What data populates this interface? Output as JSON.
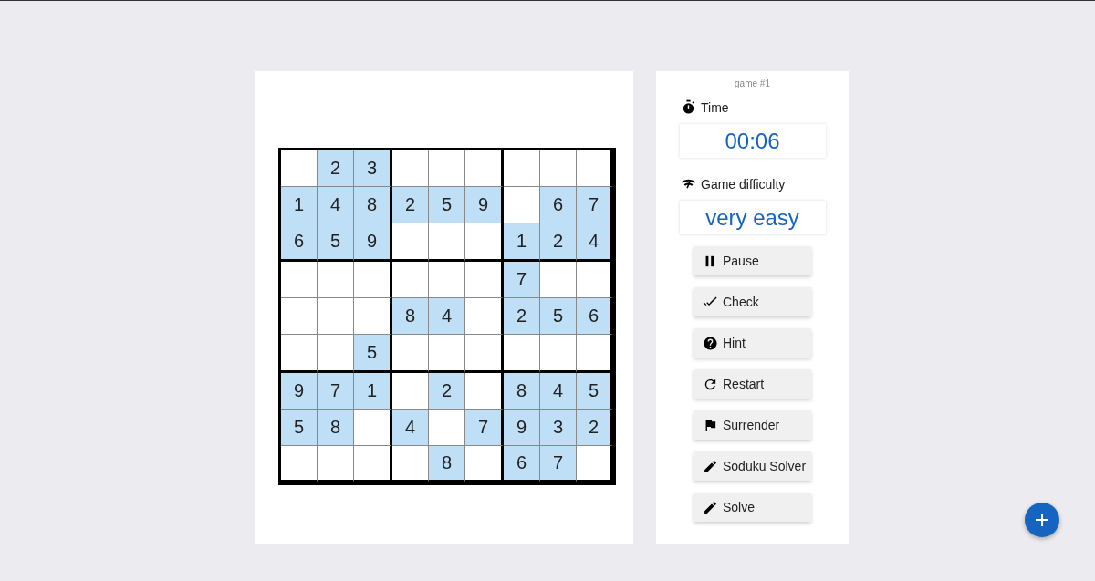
{
  "grid": {
    "rows": [
      {
        "cells": [
          {
            "given": false
          },
          {
            "value": "2",
            "given": true
          },
          {
            "value": "3",
            "given": true
          },
          {
            "given": false
          },
          {
            "given": false
          },
          {
            "given": false
          },
          {
            "given": false
          },
          {
            "given": false
          },
          {
            "given": false
          }
        ]
      },
      {
        "cells": [
          {
            "value": "1",
            "given": true
          },
          {
            "value": "4",
            "given": true
          },
          {
            "value": "8",
            "given": true
          },
          {
            "value": "2",
            "given": true
          },
          {
            "value": "5",
            "given": true
          },
          {
            "value": "9",
            "given": true
          },
          {
            "given": false
          },
          {
            "value": "6",
            "given": true
          },
          {
            "value": "7",
            "given": true
          }
        ]
      },
      {
        "cells": [
          {
            "value": "6",
            "given": true
          },
          {
            "value": "5",
            "given": true
          },
          {
            "value": "9",
            "given": true
          },
          {
            "given": false
          },
          {
            "given": false
          },
          {
            "given": false
          },
          {
            "value": "1",
            "given": true
          },
          {
            "value": "2",
            "given": true
          },
          {
            "value": "4",
            "given": true
          }
        ]
      },
      {
        "cells": [
          {
            "given": false
          },
          {
            "given": false
          },
          {
            "given": false
          },
          {
            "given": false
          },
          {
            "given": false
          },
          {
            "given": false
          },
          {
            "value": "7",
            "given": true
          },
          {
            "given": false
          },
          {
            "given": false
          }
        ]
      },
      {
        "cells": [
          {
            "given": false
          },
          {
            "given": false
          },
          {
            "given": false
          },
          {
            "value": "8",
            "given": true
          },
          {
            "value": "4",
            "given": true
          },
          {
            "given": false
          },
          {
            "value": "2",
            "given": true
          },
          {
            "value": "5",
            "given": true
          },
          {
            "value": "6",
            "given": true
          }
        ]
      },
      {
        "cells": [
          {
            "given": false
          },
          {
            "given": false
          },
          {
            "value": "5",
            "given": true
          },
          {
            "given": false
          },
          {
            "given": false
          },
          {
            "given": false
          },
          {
            "given": false
          },
          {
            "given": false
          },
          {
            "given": false
          }
        ]
      },
      {
        "cells": [
          {
            "value": "9",
            "given": true
          },
          {
            "value": "7",
            "given": true
          },
          {
            "value": "1",
            "given": true
          },
          {
            "given": false
          },
          {
            "value": "2",
            "given": true
          },
          {
            "given": false
          },
          {
            "value": "8",
            "given": true
          },
          {
            "value": "4",
            "given": true
          },
          {
            "value": "5",
            "given": true
          }
        ]
      },
      {
        "cells": [
          {
            "value": "5",
            "given": true
          },
          {
            "value": "8",
            "given": true
          },
          {
            "given": false
          },
          {
            "value": "4",
            "given": true
          },
          {
            "given": false
          },
          {
            "value": "7",
            "given": true
          },
          {
            "value": "9",
            "given": true
          },
          {
            "value": "3",
            "given": true
          },
          {
            "value": "2",
            "given": true
          }
        ]
      },
      {
        "cells": [
          {
            "given": false
          },
          {
            "given": false
          },
          {
            "given": false
          },
          {
            "given": false
          },
          {
            "value": "8",
            "given": true
          },
          {
            "given": false
          },
          {
            "value": "6",
            "given": true
          },
          {
            "value": "7",
            "given": true
          },
          {
            "given": false
          }
        ]
      }
    ]
  },
  "panel": {
    "game_label": "game #1",
    "time_label": "Time",
    "time_value": "00:06",
    "difficulty_label": "Game difficulty",
    "difficulty_value": "very easy",
    "buttons": [
      {
        "label": "Pause",
        "kind": "pause"
      },
      {
        "label": "Check",
        "kind": "check"
      },
      {
        "label": "Hint",
        "kind": "hint"
      },
      {
        "label": "Restart",
        "kind": "restart"
      },
      {
        "label": "Surrender",
        "kind": "flag"
      },
      {
        "label": "Soduku Solver",
        "kind": "pencil"
      },
      {
        "label": "Solve",
        "kind": "pencil"
      }
    ]
  }
}
